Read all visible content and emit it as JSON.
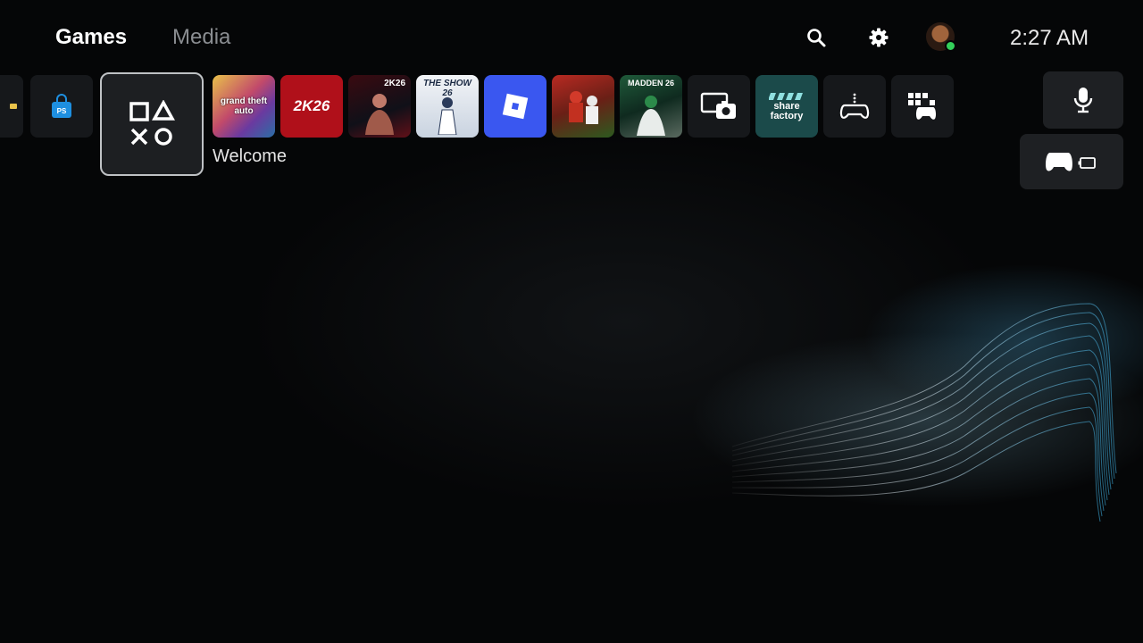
{
  "top_bar": {
    "tabs": [
      {
        "label": "Games",
        "active": true
      },
      {
        "label": "Media",
        "active": false
      }
    ],
    "icons": [
      "search-icon",
      "settings-icon",
      "profile-avatar"
    ],
    "clock": "2:27 AM",
    "online_status_color": "#33d05a"
  },
  "game_row": {
    "selected_label": "Welcome",
    "tiles": [
      {
        "name": "partial-tile",
        "label": ""
      },
      {
        "name": "playstation-store",
        "label": ""
      },
      {
        "name": "welcome-hub",
        "label": "Welcome"
      },
      {
        "name": "gta-v",
        "label": "grand theft auto"
      },
      {
        "name": "nba-2k26",
        "label": "2K26"
      },
      {
        "name": "wwe-2k26",
        "label": "2K26"
      },
      {
        "name": "mlb-the-show-26",
        "label": "THE SHOW 26"
      },
      {
        "name": "roblox",
        "label": ""
      },
      {
        "name": "college-football-26",
        "label": ""
      },
      {
        "name": "madden-nfl-26",
        "label": "MADDEN 26"
      },
      {
        "name": "media-gallery",
        "label": ""
      },
      {
        "name": "share-factory",
        "label": "share factory"
      },
      {
        "name": "ps-remote-play",
        "label": ""
      },
      {
        "name": "game-library",
        "label": ""
      }
    ]
  },
  "right_panel": {
    "items": [
      "microphone-icon",
      "controller-battery-icon"
    ]
  },
  "colors": {
    "background": "#050607",
    "active_tab": "#ffffff",
    "inactive_tab": "#8a8d91",
    "roblox_blue": "#3a57f0",
    "nba_red": "#b0101a"
  }
}
